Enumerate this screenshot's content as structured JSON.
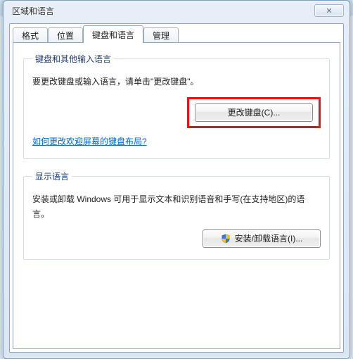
{
  "window": {
    "title": "区域和语言"
  },
  "tabs": {
    "t0": "格式",
    "t1": "位置",
    "t2": "键盘和语言",
    "t3": "管理"
  },
  "group1": {
    "legend": "键盘和其他输入语言",
    "desc": "要更改键盘或输入语言，请单击\"更改键盘\"。",
    "button": "更改键盘(C)...",
    "link": "如何更改欢迎屏幕的键盘布局?"
  },
  "group2": {
    "legend": "显示语言",
    "desc": "安装或卸载 Windows 可用于显示文本和识别语音和手写(在支持地区)的语言。",
    "button": "安装/卸载语言(I)..."
  }
}
